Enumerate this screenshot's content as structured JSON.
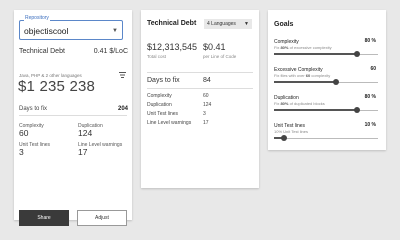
{
  "card1": {
    "repository_label": "Repository",
    "repository_value": "objectiscool",
    "technical_debt_label": "Technical Debt",
    "technical_debt_value": "0.41 $/LoC",
    "languages_text": "Java, PHP & 2 other languages",
    "total_cost": "$1 235 238",
    "days_to_fix_label": "Days to fix",
    "days_to_fix_value": "204",
    "metrics": [
      {
        "label": "Complexity",
        "value": "60"
      },
      {
        "label": "Duplication",
        "value": "124"
      },
      {
        "label": "Unit Test lines",
        "value": "3"
      },
      {
        "label": "Line Level warnings",
        "value": "17"
      }
    ],
    "share_label": "Share",
    "adjust_label": "Adjust"
  },
  "card2": {
    "title": "Technical Debt",
    "language_select": "4 Languages",
    "total_cost": "$12,313,545",
    "total_cost_label": "Total cost",
    "per_loc": "$0.41",
    "per_loc_label": "per Line of Code",
    "days_to_fix_label": "Days to fix",
    "days_to_fix_value": "84",
    "rows": [
      {
        "label": "Complexity",
        "value": "60"
      },
      {
        "label": "Duplication",
        "value": "124"
      },
      {
        "label": "Unit Test lines",
        "value": "3"
      },
      {
        "label": "Line Level warnings",
        "value": "17"
      }
    ]
  },
  "card3": {
    "title": "Goals",
    "goals": [
      {
        "name": "Complexity",
        "percent": "80 %",
        "desc_pre": "Fix ",
        "desc_bold": "80%",
        "desc_post": " of excessive complexity",
        "level": 0.8
      },
      {
        "name": "Excessive Complexity",
        "percent": "60",
        "desc_pre": "Fix files with over ",
        "desc_bold": "60",
        "desc_post": " complexity",
        "level": 0.6
      },
      {
        "name": "Duplication",
        "percent": "80 %",
        "desc_pre": "Fix ",
        "desc_bold": "80%",
        "desc_post": " of duplicated blocks",
        "level": 0.8
      },
      {
        "name": "Unit Test lines",
        "percent": "10 %",
        "desc_pre": "10% Unit Test lines",
        "desc_bold": "",
        "desc_post": "",
        "level": 0.1
      }
    ]
  }
}
